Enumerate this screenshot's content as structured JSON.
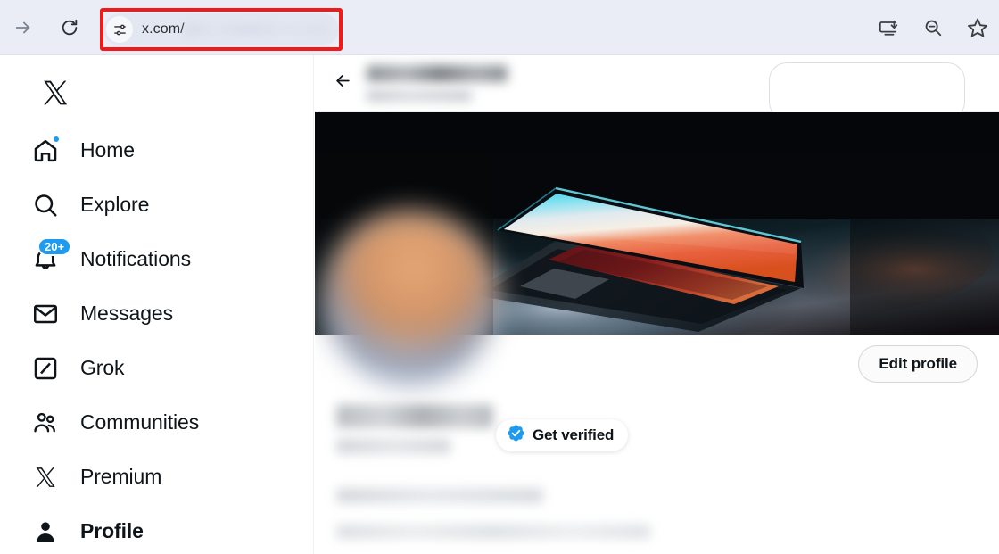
{
  "browser": {
    "forward_label": "Forward",
    "reload_label": "Reload",
    "url_text": "x.com/",
    "url_redacted": true,
    "highlight_color": "#f01a18",
    "right_actions": [
      {
        "name": "install-app-icon",
        "label": "Install this site as an app"
      },
      {
        "name": "zoom-out-icon",
        "label": "Zoom out"
      },
      {
        "name": "bookmark-star-icon",
        "label": "Bookmark this tab"
      }
    ]
  },
  "sidebar": {
    "logo_label": "X",
    "items": [
      {
        "label": "Home",
        "icon": "home-icon",
        "badge": "",
        "badge_type": "dot",
        "active": false
      },
      {
        "label": "Explore",
        "icon": "search-icon",
        "badge": "",
        "badge_type": "none",
        "active": false
      },
      {
        "label": "Notifications",
        "icon": "bell-icon",
        "badge": "20+",
        "badge_type": "count",
        "active": false
      },
      {
        "label": "Messages",
        "icon": "envelope-icon",
        "badge": "",
        "badge_type": "none",
        "active": false
      },
      {
        "label": "Grok",
        "icon": "grok-icon",
        "badge": "",
        "badge_type": "none",
        "active": false
      },
      {
        "label": "Communities",
        "icon": "communities-icon",
        "badge": "",
        "badge_type": "none",
        "active": false
      },
      {
        "label": "Premium",
        "icon": "x-logo-icon",
        "badge": "",
        "badge_type": "none",
        "active": false
      },
      {
        "label": "Profile",
        "icon": "person-icon",
        "badge": "",
        "badge_type": "none",
        "active": true
      }
    ]
  },
  "profile": {
    "header": {
      "back_label": "Back",
      "name_redacted": true,
      "subtitle_redacted": true,
      "search_placeholder": ""
    },
    "banner_alt": "Open laptop with colorful gradient screen on a dark desk",
    "avatar_redacted": true,
    "edit_profile_label": "Edit profile",
    "get_verified_label": "Get verified",
    "verified_badge_color": "#1d9bf0",
    "name_redacted": true,
    "handle_redacted": true,
    "bio_redacted": true,
    "meta_redacted": true
  },
  "colors": {
    "accent_blue": "#1d9bf0",
    "toolbar_bg": "#eaedf6",
    "text_primary": "#0f1419"
  }
}
